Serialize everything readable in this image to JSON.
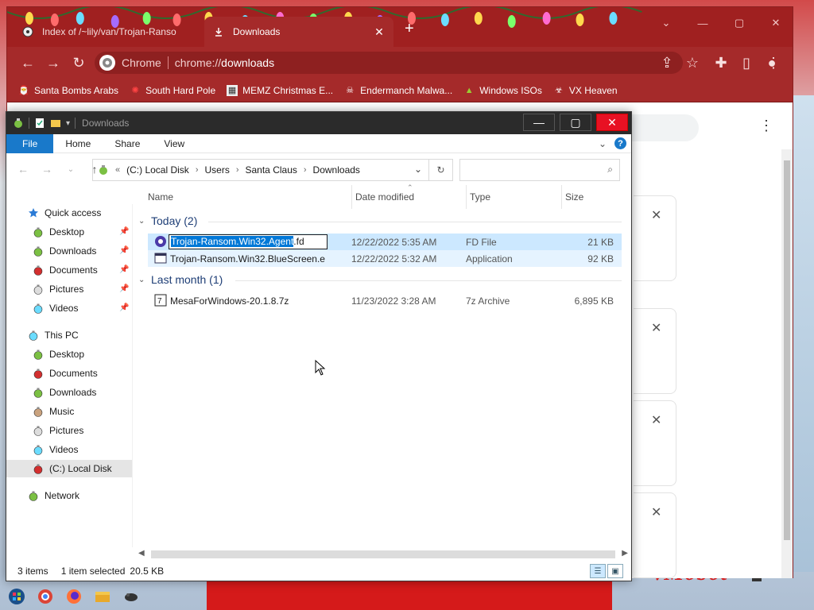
{
  "chrome": {
    "tabs": [
      {
        "title": "Index of /~lily/van/Trojan-Ranso",
        "icon": "web-favicon-icon",
        "active": false
      },
      {
        "title": "Downloads",
        "icon": "download-icon",
        "active": true
      }
    ],
    "omnibox": {
      "chip": "Chrome",
      "url_prefix": "chrome://",
      "url_host": "downloads"
    },
    "bookmarks": [
      {
        "label": "Santa Bombs Arabs",
        "icon": "santa-icon"
      },
      {
        "label": "South Hard Pole",
        "icon": "star-icon"
      },
      {
        "label": "MEMZ Christmas E...",
        "icon": "image-icon"
      },
      {
        "label": "Endermanch Malwa...",
        "icon": "skull-icon"
      },
      {
        "label": "Windows ISOs",
        "icon": "tree-icon"
      },
      {
        "label": "VX Heaven",
        "icon": "biohazard-icon"
      }
    ],
    "wallpaper_text": "vMobot"
  },
  "explorer": {
    "title": "Downloads",
    "ribbon_tabs": [
      "File",
      "Home",
      "Share",
      "View"
    ],
    "breadcrumb": [
      "(C:) Local Disk",
      "Users",
      "Santa Claus",
      "Downloads"
    ],
    "breadcrumb_lead": "«",
    "search_placeholder": "",
    "columns": {
      "name": "Name",
      "date": "Date modified",
      "type": "Type",
      "size": "Size"
    },
    "sidebar": [
      {
        "label": "Quick access",
        "icon": "star-icon",
        "level": 0
      },
      {
        "label": "Desktop",
        "icon": "ornament-icon",
        "level": 1,
        "pinned": true
      },
      {
        "label": "Downloads",
        "icon": "ornament-icon",
        "level": 1,
        "pinned": true
      },
      {
        "label": "Documents",
        "icon": "ornament-icon",
        "level": 1,
        "pinned": true
      },
      {
        "label": "Pictures",
        "icon": "ornament-icon",
        "level": 1,
        "pinned": true
      },
      {
        "label": "Videos",
        "icon": "ornament-icon",
        "level": 1,
        "pinned": true
      },
      {
        "label": "This PC",
        "icon": "ornament-icon",
        "level": 0
      },
      {
        "label": "Desktop",
        "icon": "ornament-icon",
        "level": 1
      },
      {
        "label": "Documents",
        "icon": "ornament-icon",
        "level": 1
      },
      {
        "label": "Downloads",
        "icon": "ornament-icon",
        "level": 1
      },
      {
        "label": "Music",
        "icon": "ornament-icon",
        "level": 1
      },
      {
        "label": "Pictures",
        "icon": "ornament-icon",
        "level": 1
      },
      {
        "label": "Videos",
        "icon": "ornament-icon",
        "level": 1
      },
      {
        "label": "(C:) Local Disk",
        "icon": "ornament-icon",
        "level": 1,
        "selected": true
      },
      {
        "label": "Network",
        "icon": "ornament-icon",
        "level": 0
      }
    ],
    "groups": [
      {
        "label": "Today (2)",
        "files": [
          {
            "name": "Trojan-Ransom.Win32.Agent.fd",
            "rename_selected": "Trojan-Ransom.Win32.Agent",
            "rename_rest": ".fd",
            "date": "12/22/2022 5:35 AM",
            "type": "FD File",
            "size": "21 KB",
            "selected": true,
            "icon": "fd-file-icon"
          },
          {
            "name": "Trojan-Ransom.Win32.BlueScreen.e",
            "date": "12/22/2022 5:32 AM",
            "type": "Application",
            "size": "92 KB",
            "hover": true,
            "icon": "application-icon"
          }
        ]
      },
      {
        "label": "Last month (1)",
        "files": [
          {
            "name": "MesaForWindows-20.1.8.7z",
            "date": "11/23/2022 3:28 AM",
            "type": "7z Archive",
            "size": "6,895 KB",
            "icon": "7z-archive-icon"
          }
        ]
      }
    ],
    "status": {
      "items": "3 items",
      "selected": "1 item selected",
      "size": "20.5 KB"
    }
  },
  "colors": {
    "chrome_frame": "#a52a2a",
    "explorer_accent": "#1979ca",
    "selection": "#cce8ff"
  }
}
